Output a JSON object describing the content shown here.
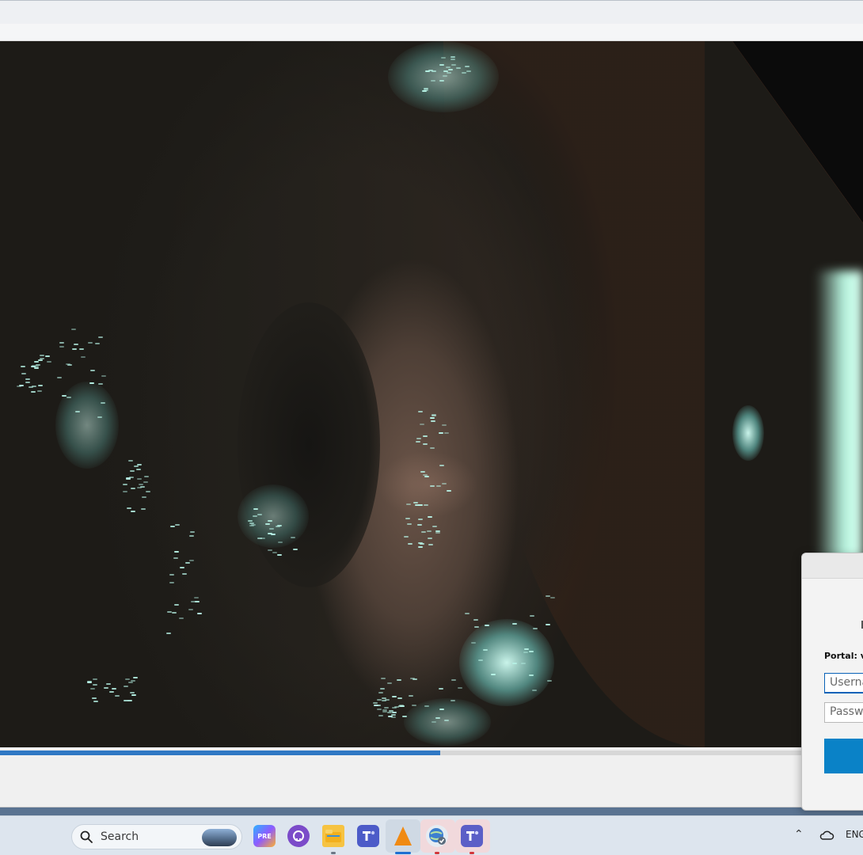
{
  "window": {
    "playback_progress_percent": 51
  },
  "vpn_dialog": {
    "portal_label": "Portal: vp",
    "username_placeholder": "Userna",
    "password_placeholder": "Passwo"
  },
  "taskbar": {
    "search_label": "Search",
    "copilot_badge": "PRE",
    "tray_language": "ENG",
    "icons": [
      "windows-start-icon",
      "search-icon",
      "copilot-icon",
      "github-icon",
      "file-explorer-icon",
      "teams-icon",
      "vlc-icon",
      "browser-globe-icon",
      "teams-icon"
    ]
  },
  "colors": {
    "accent": "#2f78c4",
    "connect_button": "#0a82c7",
    "taskbar": "#dde5ee"
  }
}
